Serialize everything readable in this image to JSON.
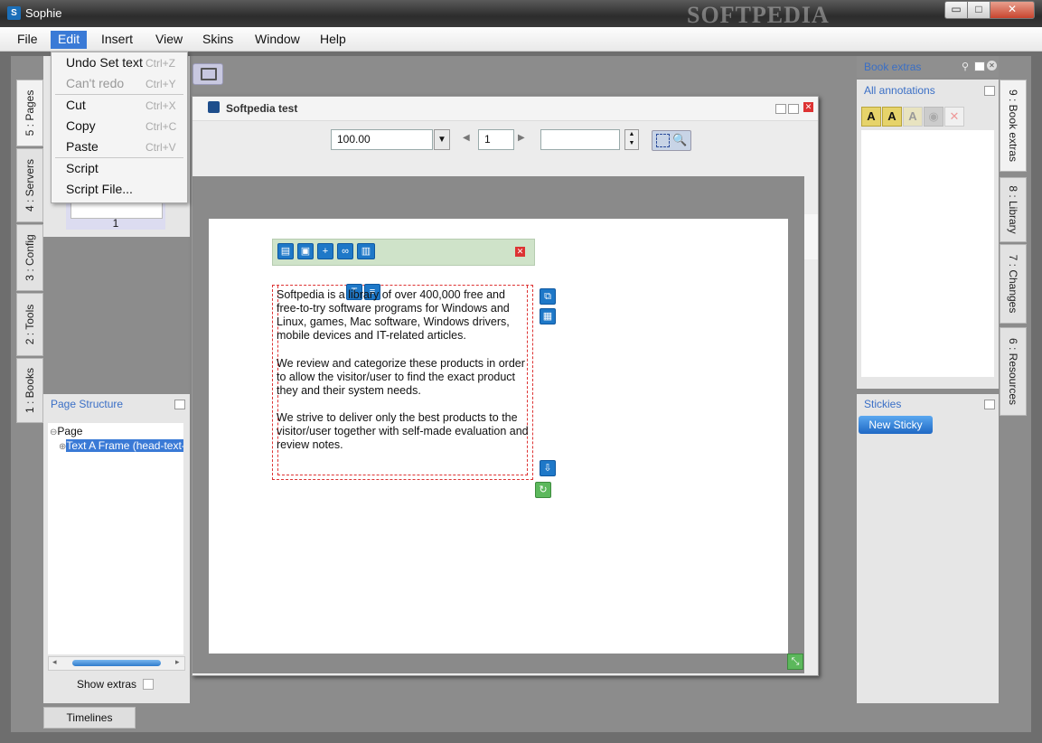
{
  "window": {
    "title": "Sophie",
    "watermark": "SOFTPEDIA",
    "min": "▭",
    "max": "□",
    "close": "✕"
  },
  "menubar": [
    "File",
    "Edit",
    "Insert",
    "View",
    "Skins",
    "Window",
    "Help"
  ],
  "edit_menu": {
    "items": [
      {
        "label": "Undo Set text",
        "shortcut": "Ctrl+Z"
      },
      {
        "label": "Can't redo",
        "shortcut": "Ctrl+Y"
      },
      {
        "label": "Cut",
        "shortcut": "Ctrl+X"
      },
      {
        "label": "Copy",
        "shortcut": "Ctrl+C"
      },
      {
        "label": "Paste",
        "shortcut": "Ctrl+V"
      },
      {
        "label": "Script",
        "shortcut": ""
      },
      {
        "label": "Script File...",
        "shortcut": ""
      }
    ]
  },
  "left_tabs": [
    "5 : Pages",
    "4 : Servers",
    "3 : Config",
    "2 : Tools",
    "1 : Books"
  ],
  "pages_panel": {
    "page_number": "1"
  },
  "page_structure": {
    "title": "Page Structure",
    "tree": [
      {
        "label": "Page"
      },
      {
        "label": "Text A Frame (head-text-"
      }
    ],
    "show_extras": "Show extras"
  },
  "timelines_tab": "Timelines",
  "document": {
    "title": "Softpedia test",
    "zoom": "100.00",
    "page_field": "1",
    "text_paragraphs": [
      "Softpedia is a library of over 400,000 free and free-to-try software programs for Windows and Linux, games, Mac software, Windows drivers, mobile devices and IT-related articles.",
      "We review and categorize these products in order to allow the visitor/user to find the exact product they and their system needs.",
      "We strive to deliver only the best products to the visitor/user together with self-made evaluation and review notes."
    ]
  },
  "right_panel": {
    "book_extras": "Book extras",
    "all_annotations": "All annotations",
    "stickies": "Stickies",
    "new_sticky": "New Sticky",
    "right_tabs": [
      "9 : Book extras",
      "8 : Library",
      "7 : Changes",
      "6 : Resources"
    ]
  },
  "colors": {
    "accent": "#3a7ad6",
    "panel_header": "#3a6fc6",
    "frame_border": "#dd3333",
    "toolbar_green": "#cfe3c9"
  }
}
